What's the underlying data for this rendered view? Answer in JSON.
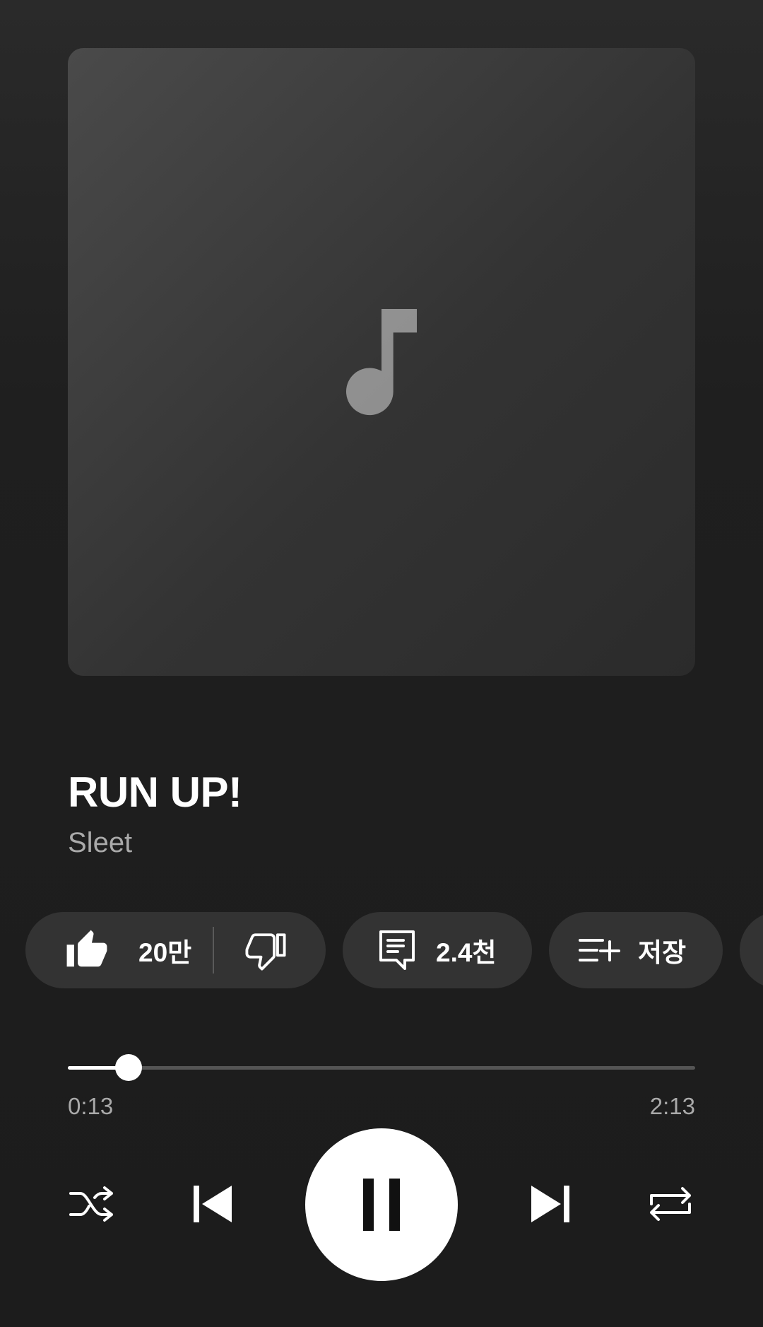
{
  "track": {
    "title": "RUN UP!",
    "artist": "Sleet",
    "artwork_icon": "music-note-icon"
  },
  "actions": {
    "like_count": "20만",
    "comment_count": "2.4천",
    "save_label": "저장"
  },
  "playback": {
    "current_time": "0:13",
    "total_time": "2:13",
    "progress_fraction": 0.097,
    "state": "playing"
  },
  "icons": {
    "like": "thumbs-up-icon",
    "dislike": "thumbs-down-icon",
    "comment": "comment-icon",
    "save": "add-to-playlist-icon",
    "shuffle": "shuffle-icon",
    "previous": "skip-previous-icon",
    "pause": "pause-icon",
    "next": "skip-next-icon",
    "repeat": "repeat-icon"
  },
  "colors": {
    "background": "#1c1c1c",
    "chip": "#333333",
    "accent": "#ffffff",
    "secondary_text": "#aaaaaa"
  }
}
